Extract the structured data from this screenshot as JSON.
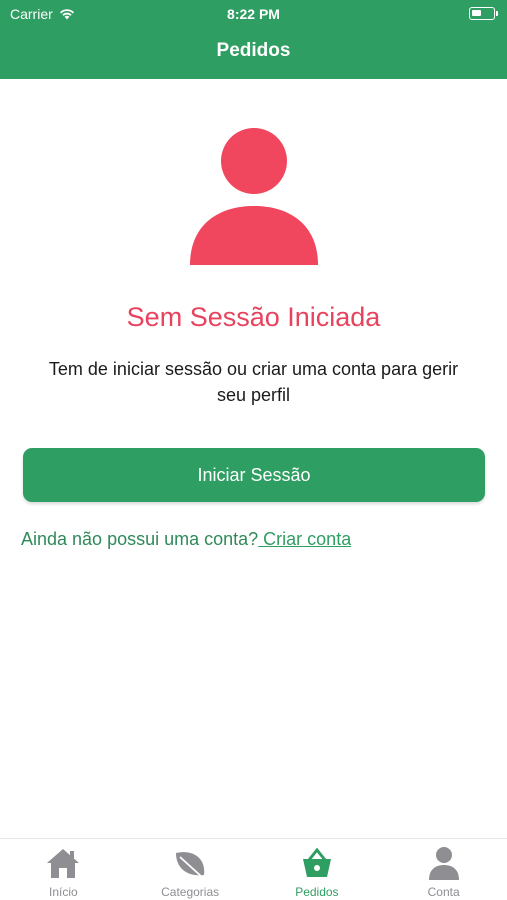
{
  "status_bar": {
    "carrier": "Carrier",
    "time": "8:22 PM"
  },
  "header": {
    "title": "Pedidos"
  },
  "main": {
    "title": "Sem Sessão Iniciada",
    "description": "Tem de iniciar sessão ou criar uma conta para gerir seu perfil",
    "login_button": "Iniciar Sessão",
    "signup_prompt": "Ainda não possui uma conta?",
    "signup_link": " Criar conta"
  },
  "tabs": [
    {
      "label": "Início",
      "icon": "home-icon"
    },
    {
      "label": "Categorias",
      "icon": "leaf-icon"
    },
    {
      "label": "Pedidos",
      "icon": "basket-icon",
      "active": true
    },
    {
      "label": "Conta",
      "icon": "user-icon"
    }
  ],
  "colors": {
    "primary": "#2f9e62",
    "accent": "#e8435e",
    "tab_inactive": "#8e8e93"
  }
}
